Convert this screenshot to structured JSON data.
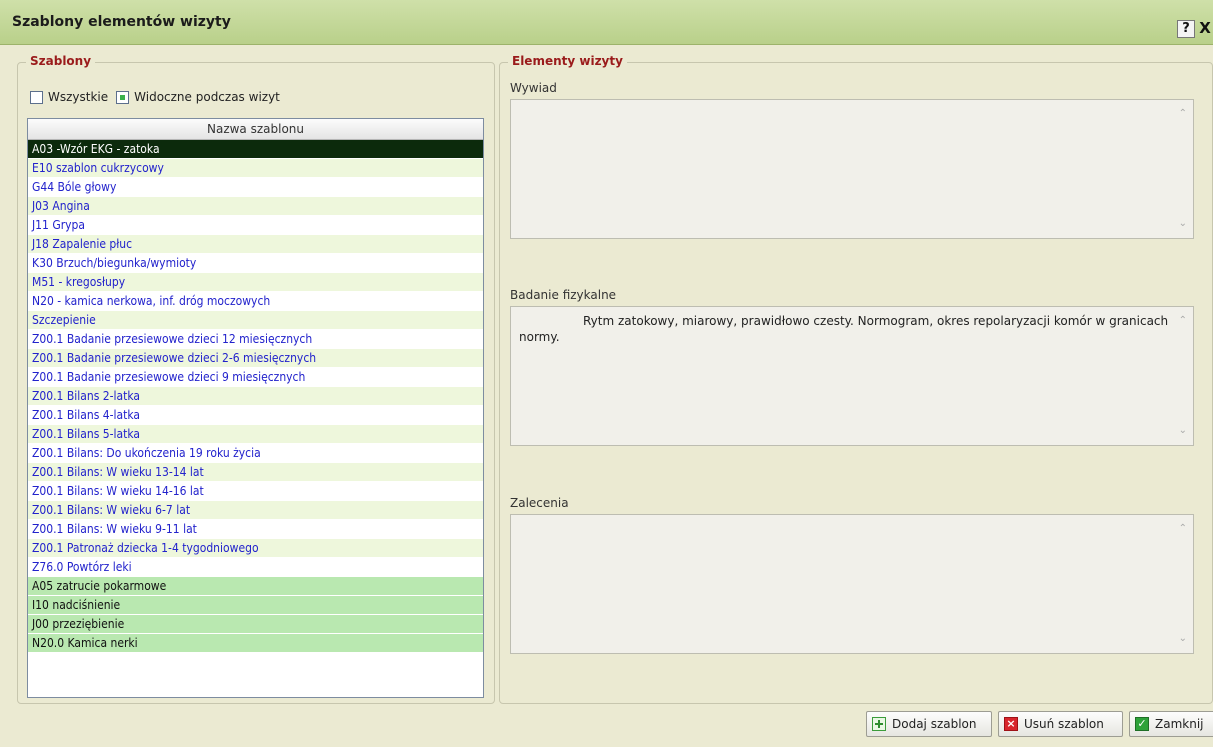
{
  "window": {
    "title": "Szablony elementów wizyty",
    "help_label": "?",
    "close_label": "X"
  },
  "templates": {
    "legend": "Szablony",
    "filter_all": {
      "label": "Wszystkie",
      "checked": false
    },
    "filter_visible": {
      "label": "Widoczne podczas wizyt",
      "checked": true
    },
    "column_header": "Nazwa szablonu",
    "rows": [
      "A03 -Wzór EKG - zatoka",
      "E10 szablon cukrzycowy",
      "G44 Bóle głowy",
      "J03 Angina",
      "J11 Grypa",
      "J18 Zapalenie płuc",
      "K30 Brzuch/biegunka/wymioty",
      "M51 - kregosłupy",
      "N20 - kamica nerkowa, inf. dróg moczowych",
      "Szczepienie",
      "Z00.1 Badanie przesiewowe dzieci 12 miesięcznych",
      "Z00.1 Badanie przesiewowe dzieci 2-6 miesięcznych",
      "Z00.1 Badanie przesiewowe dzieci 9 miesięcznych",
      "Z00.1 Bilans 2-latka",
      "Z00.1 Bilans 4-latka",
      "Z00.1 Bilans 5-latka",
      "Z00.1 Bilans: Do ukończenia 19 roku życia",
      "Z00.1 Bilans: W wieku 13-14 lat",
      "Z00.1 Bilans: W wieku 14-16 lat",
      "Z00.1 Bilans: W wieku 6-7 lat",
      "Z00.1 Bilans: W wieku 9-11 lat",
      "Z00.1 Patronaż dziecka 1-4 tygodniowego",
      "Z76.0 Powtórz leki",
      "A05 zatrucie pokarmowe",
      "I10 nadciśnienie",
      "J00 przeziębienie",
      "N20.0 Kamica nerki"
    ],
    "selected_index": 0,
    "green_from_index": 23
  },
  "elements": {
    "legend": "Elementy wizyty",
    "interview_label": "Wywiad",
    "interview_value": "",
    "exam_label": "Badanie fizykalne",
    "exam_value": "Rytm zatokowy, miarowy, prawidłowo czesty. Normogram, okres repolaryzacji komór w granicach normy.",
    "recommendations_label": "Zalecenia",
    "recommendations_value": ""
  },
  "buttons": {
    "add": "Dodaj szablon",
    "delete": "Usuń szablon",
    "close": "Zamknij"
  },
  "colors": {
    "title_bar": "#bdd38f",
    "legend_text": "#9a1b1b",
    "row_text": "#2222cc",
    "row_selected": "#0c2a0c",
    "row_green": "#b9e8b0"
  }
}
